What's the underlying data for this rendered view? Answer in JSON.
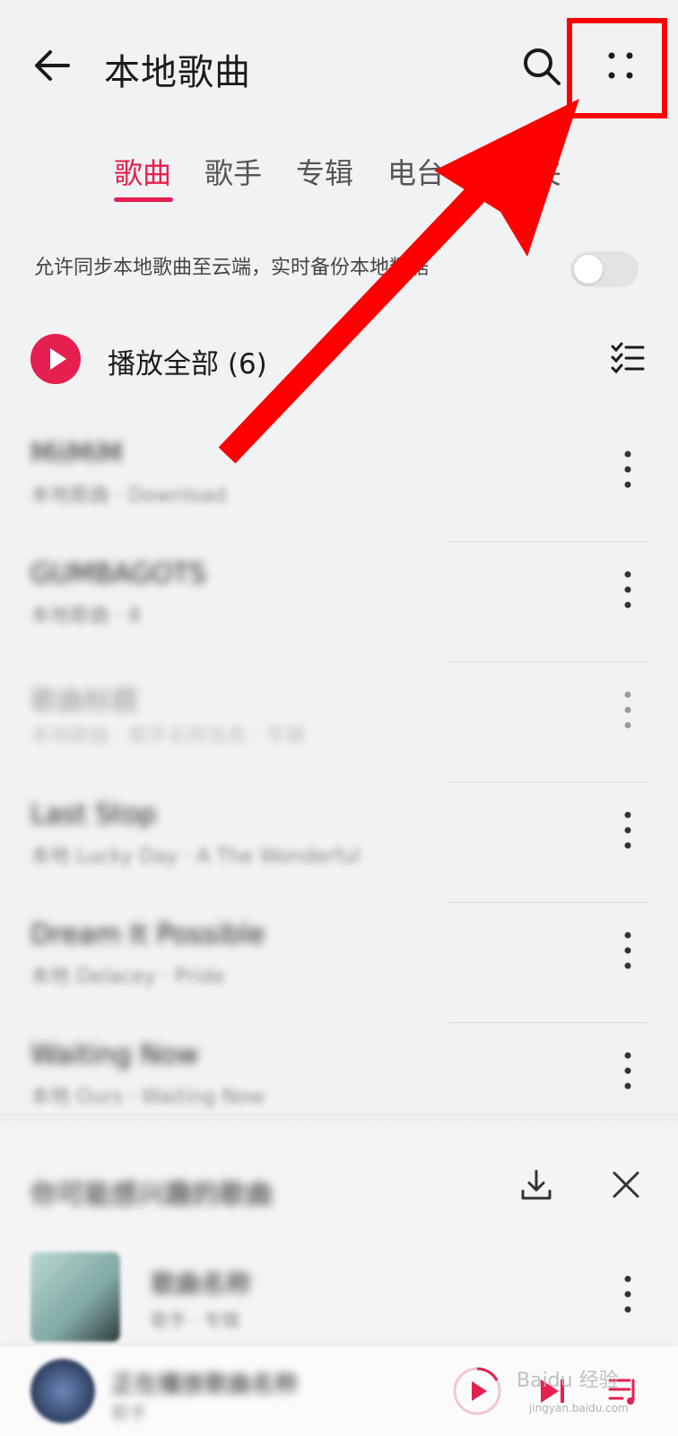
{
  "header": {
    "title": "本地歌曲"
  },
  "tabs": [
    {
      "label": "歌曲",
      "active": true
    },
    {
      "label": "歌手",
      "active": false
    },
    {
      "label": "专辑",
      "active": false
    },
    {
      "label": "电台",
      "active": false
    },
    {
      "label": "夹",
      "active": false
    }
  ],
  "sync": {
    "text": "允许同步本地歌曲至云端，实时备份本地数据",
    "enabled": false
  },
  "play_all": {
    "label": "播放全部 (6)"
  },
  "songs": [
    {
      "name": "MiiMiM",
      "meta": "本地歌曲 · Download"
    },
    {
      "name": "GUMBAGOTS",
      "meta": "本地歌曲 · 8"
    },
    {
      "name": "歌曲标题",
      "meta": "本地歌曲 · 歌手名称信息 · 专辑"
    },
    {
      "name": "Last Stop",
      "meta": "本地 Lucky Day · A The Wonderful"
    },
    {
      "name": "Dream It Possible",
      "meta": "本地 Delacey · Pride"
    },
    {
      "name": "Waiting Now",
      "meta": "本地 Ours · Waiting Now"
    }
  ],
  "recommend_panel": {
    "title": "你可能感兴趣的歌曲",
    "item": {
      "title": "歌曲名称",
      "meta": "歌手 · 专辑"
    }
  },
  "mini_player": {
    "title": "正在播放歌曲名称",
    "subtitle": "歌手"
  },
  "watermark": {
    "text": "Baidu 经验",
    "sub": "jingyan.baidu.com"
  },
  "colors": {
    "accent": "#e61f51",
    "annotation": "#ff0000"
  },
  "icons": [
    "back-arrow-icon",
    "search-icon",
    "more-dots-icon",
    "play-icon",
    "multi-select-icon",
    "vertical-more-icon",
    "download-icon",
    "close-icon",
    "next-track-icon",
    "queue-icon"
  ]
}
